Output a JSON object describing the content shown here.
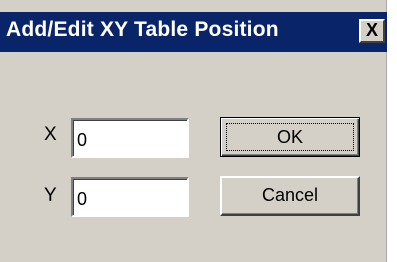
{
  "dialog": {
    "title": "Add/Edit XY Table Position",
    "close_label": "X"
  },
  "fields": {
    "x_label": "X",
    "x_value": "0",
    "y_label": "Y",
    "y_value": "0"
  },
  "buttons": {
    "ok_label": "OK",
    "cancel_label": "Cancel"
  },
  "colors": {
    "titlebar": "#0a246a",
    "face": "#d4d0c8"
  }
}
